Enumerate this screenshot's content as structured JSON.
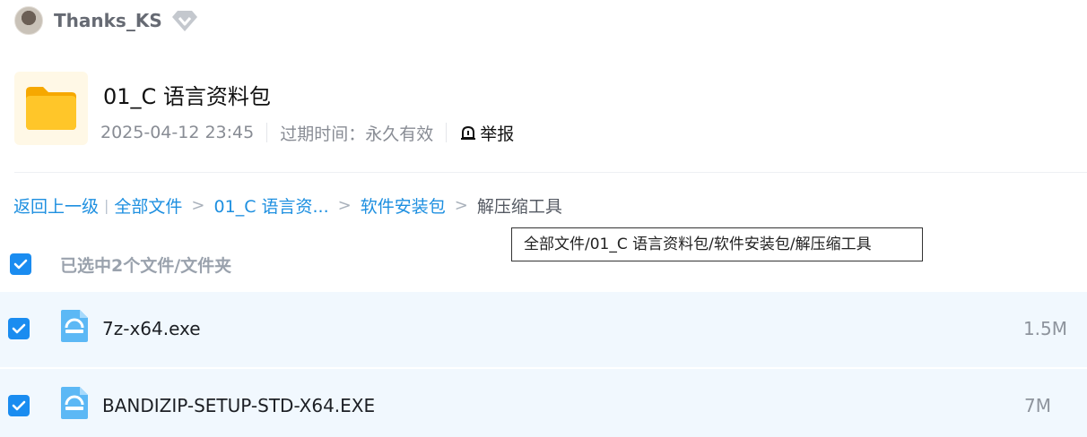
{
  "user": {
    "name": "Thanks_KS"
  },
  "share": {
    "title": "01_C 语言资料包",
    "date": "2025-04-12 23:45",
    "expire": "过期时间：永久有效",
    "report_label": "举报"
  },
  "breadcrumb": {
    "back": "返回上一级",
    "sep": "|",
    "root": "全部文件",
    "gt": ">",
    "level1": "01_C 语言资...",
    "level2": "软件安装包",
    "current": "解压缩工具"
  },
  "tooltip": {
    "text": "全部文件/01_C 语言资料包/软件安装包/解压缩工具"
  },
  "selection": {
    "text": "已选中2个文件/文件夹"
  },
  "files": [
    {
      "name": "7z-x64.exe",
      "size": "1.5M"
    },
    {
      "name": "BANDIZIP-SETUP-STD-X64.EXE",
      "size": "7M"
    }
  ],
  "colors": {
    "accent": "#1a8cf0",
    "link": "#1d8fe0",
    "row_bg": "#f1f8fe",
    "folder": "#ffc20e",
    "exe_icon": "#5cb8f5"
  }
}
